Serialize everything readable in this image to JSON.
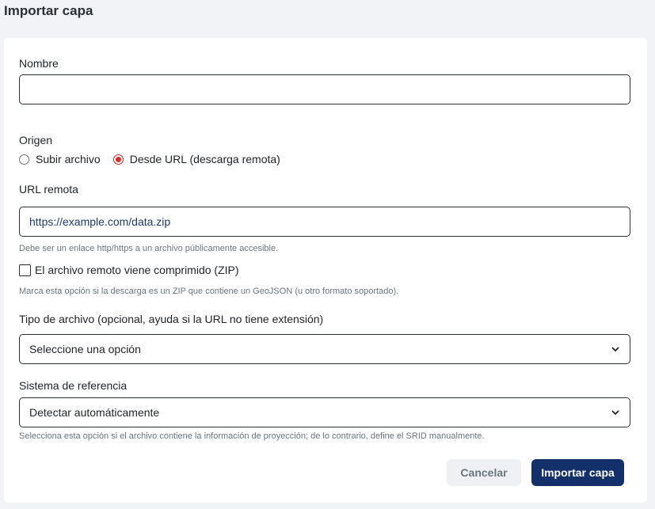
{
  "header": {
    "title": "Importar capa"
  },
  "form": {
    "name": {
      "label": "Nombre",
      "value": ""
    },
    "origin": {
      "label": "Origen",
      "options": [
        "Subir archivo",
        "Desde URL (descarga remota)"
      ],
      "selected": "Desde URL (descarga remota)"
    },
    "remote_url": {
      "label": "URL remota",
      "value": "https://example.com/data.zip",
      "help": "Debe ser un enlace http/https a un archivo públicamente accesible."
    },
    "compressed": {
      "label": "El archivo remoto viene comprimido (ZIP)",
      "checked": false,
      "help": "Marca esta opción si la descarga es un ZIP que contiene un GeoJSON (u otro formato soportado)."
    },
    "file_type": {
      "label": "Tipo de archivo (opcional, ayuda si la URL no tiene extensión)",
      "selected": "Seleccione una opción"
    },
    "srs": {
      "label": "Sistema de referencia",
      "selected": "Detectar automáticamente",
      "help": "Selecciona esta opción si el archivo contiene la información de proyección; de lo contrario, define el SRID manualmente."
    }
  },
  "actions": {
    "cancel": "Cancelar",
    "submit": "Importar capa"
  },
  "colors": {
    "primary": "#13306b",
    "radio_selected": "#d32f2f",
    "muted": "#6c757d"
  }
}
